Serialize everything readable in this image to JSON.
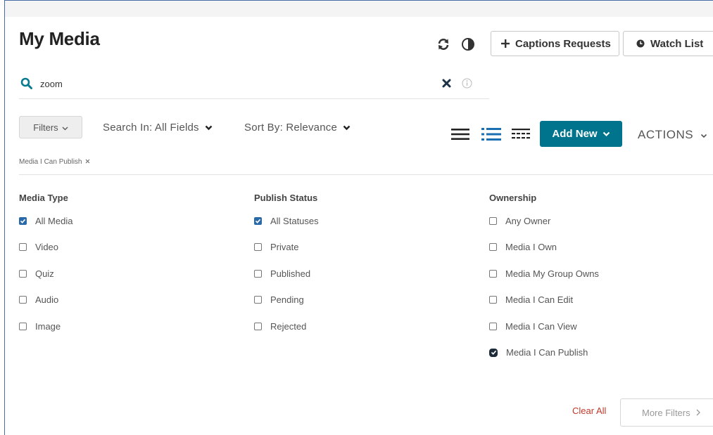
{
  "header": {
    "title": "My Media",
    "captions_label": "Captions Requests",
    "watch_list_label": "Watch List"
  },
  "search": {
    "value": "zoom",
    "placeholder": ""
  },
  "toolbar": {
    "filters_label": "Filters",
    "search_in_label": "Search In: All Fields",
    "sort_by_label": "Sort By: Relevance",
    "add_new_label": "Add New",
    "actions_label": "ACTIONS"
  },
  "active_filter_chip": "Media I Can Publish",
  "columns": [
    {
      "heading": "Media Type",
      "options": [
        {
          "label": "All Media",
          "checked": true
        },
        {
          "label": "Video",
          "checked": false
        },
        {
          "label": "Quiz",
          "checked": false
        },
        {
          "label": "Audio",
          "checked": false
        },
        {
          "label": "Image",
          "checked": false
        }
      ]
    },
    {
      "heading": "Publish Status",
      "options": [
        {
          "label": "All Statuses",
          "checked": true
        },
        {
          "label": "Private",
          "checked": false
        },
        {
          "label": "Published",
          "checked": false
        },
        {
          "label": "Pending",
          "checked": false
        },
        {
          "label": "Rejected",
          "checked": false
        }
      ]
    },
    {
      "heading": "Ownership",
      "options": [
        {
          "label": "Any Owner",
          "checked": false
        },
        {
          "label": "Media I Own",
          "checked": false
        },
        {
          "label": "Media My Group Owns",
          "checked": false
        },
        {
          "label": "Media I Can Edit",
          "checked": false
        },
        {
          "label": "Media I Can View",
          "checked": false
        },
        {
          "label": "Media I Can Publish",
          "checked": true
        }
      ]
    }
  ],
  "footer": {
    "clear_all_label": "Clear All",
    "more_filters_label": "More Filters"
  },
  "colors": {
    "accent": "#00748d",
    "search_icon": "#0a7a8f",
    "checkbox_checked": "#2a6aa8",
    "clear_all": "#c0392b"
  },
  "icons": [
    "refresh-icon",
    "contrast-icon",
    "plus-icon",
    "clock-icon",
    "search-icon",
    "clear-icon",
    "info-icon",
    "chevron-down-icon",
    "list-view-icon",
    "detailed-view-icon",
    "compact-view-icon",
    "close-icon",
    "chevron-right-icon"
  ]
}
